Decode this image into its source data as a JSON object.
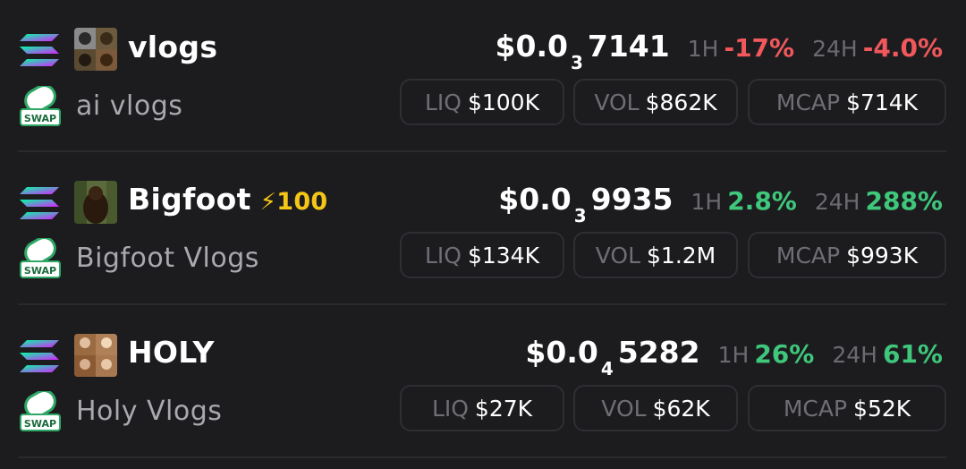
{
  "colors": {
    "background": "#1c1c1f",
    "negative": "#f0585c",
    "positive": "#3fc77b",
    "boost": "#f5c518",
    "muted": "#6e6e75"
  },
  "tokens": [
    {
      "symbol": "vlogs",
      "name": "ai vlogs",
      "boost": "",
      "price_prefix": "$0.0",
      "price_zeros": "3",
      "price_digits": "7141",
      "h1_label": "1H",
      "h1": "-17%",
      "h1_dir": "neg",
      "h24_label": "24H",
      "h24": "-4.0%",
      "h24_dir": "neg",
      "liq_label": "LIQ",
      "liq": "$100K",
      "vol_label": "VOL",
      "vol": "$862K",
      "mcap_label": "MCAP",
      "mcap": "$714K",
      "chain_icon": "solana-icon",
      "badge_icon": "swap-pill-icon",
      "badge_text": "SWAP"
    },
    {
      "symbol": "Bigfoot",
      "name": "Bigfoot Vlogs",
      "boost": "100",
      "price_prefix": "$0.0",
      "price_zeros": "3",
      "price_digits": "9935",
      "h1_label": "1H",
      "h1": "2.8%",
      "h1_dir": "pos",
      "h24_label": "24H",
      "h24": "288%",
      "h24_dir": "pos",
      "liq_label": "LIQ",
      "liq": "$134K",
      "vol_label": "VOL",
      "vol": "$1.2M",
      "mcap_label": "MCAP",
      "mcap": "$993K",
      "chain_icon": "solana-icon",
      "badge_icon": "swap-pill-icon",
      "badge_text": "SWAP"
    },
    {
      "symbol": "HOLY",
      "name": "Holy Vlogs",
      "boost": "",
      "price_prefix": "$0.0",
      "price_zeros": "4",
      "price_digits": "5282",
      "h1_label": "1H",
      "h1": "26%",
      "h1_dir": "pos",
      "h24_label": "24H",
      "h24": "61%",
      "h24_dir": "pos",
      "liq_label": "LIQ",
      "liq": "$27K",
      "vol_label": "VOL",
      "vol": "$62K",
      "mcap_label": "MCAP",
      "mcap": "$52K",
      "chain_icon": "solana-icon",
      "badge_icon": "swap-pill-icon",
      "badge_text": "SWAP"
    }
  ]
}
